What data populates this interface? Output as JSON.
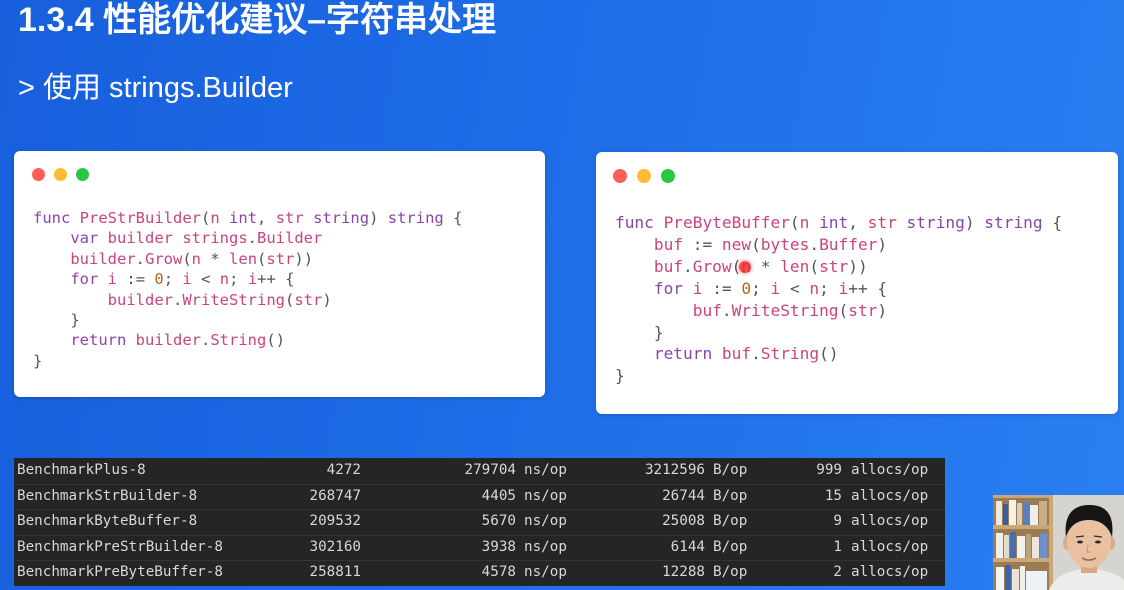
{
  "slide": {
    "title": "1.3.4 性能优化建议–字符串处理",
    "subtitle": "> 使用 strings.Builder"
  },
  "colors": {
    "window_close": "#ff5f57",
    "window_minimize": "#febc2e",
    "window_zoom": "#28c840",
    "code_keyword": "#8b44a8",
    "code_identifier": "#c9447e",
    "terminal_background": "#252525",
    "terminal_text": "#d8d8d8"
  },
  "icons": {
    "window_controls": [
      "close-dot-icon",
      "minimize-dot-icon",
      "zoom-dot-icon"
    ]
  },
  "code_cards": [
    {
      "lines": [
        "func PreStrBuilder(n int, str string) string {",
        "    var builder strings.Builder",
        "    builder.Grow(n * len(str))",
        "    for i := 0; i < n; i++ {",
        "        builder.WriteString(str)",
        "    }",
        "    return builder.String()",
        "}"
      ]
    },
    {
      "lines": [
        "func PreByteBuffer(n int, str string) string {",
        "    buf := new(bytes.Buffer)",
        "    buf.Grow(n * len(str))",
        "    for i := 0; i < n; i++ {",
        "        buf.WriteString(str)",
        "    }",
        "    return buf.String()",
        "}"
      ]
    }
  ],
  "benchmark": {
    "units": [
      "ns/op",
      "B/op",
      "allocs/op"
    ],
    "rows": [
      {
        "name": "BenchmarkPlus-8",
        "iterations": 4272,
        "ns_per_op": 279704,
        "bytes_per_op": 3212596,
        "allocs_per_op": 999
      },
      {
        "name": "BenchmarkStrBuilder-8",
        "iterations": 268747,
        "ns_per_op": 4405,
        "bytes_per_op": 26744,
        "allocs_per_op": 15
      },
      {
        "name": "BenchmarkByteBuffer-8",
        "iterations": 209532,
        "ns_per_op": 5670,
        "bytes_per_op": 25008,
        "allocs_per_op": 9
      },
      {
        "name": "BenchmarkPreStrBuilder-8",
        "iterations": 302160,
        "ns_per_op": 3938,
        "bytes_per_op": 6144,
        "allocs_per_op": 1
      },
      {
        "name": "BenchmarkPreByteBuffer-8",
        "iterations": 258811,
        "ns_per_op": 4578,
        "bytes_per_op": 12288,
        "allocs_per_op": 2
      }
    ]
  }
}
